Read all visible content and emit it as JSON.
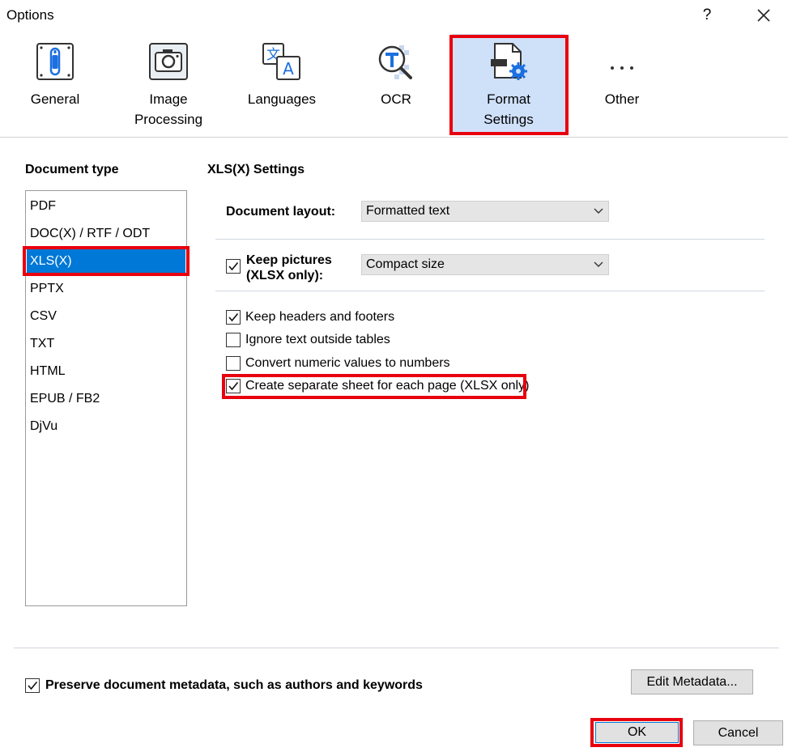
{
  "window": {
    "title": "Options",
    "help": "?"
  },
  "tabs": [
    {
      "label": "General",
      "icon": "general-icon"
    },
    {
      "label": "Image\nProcessing",
      "icon": "camera-icon"
    },
    {
      "label": "Languages",
      "icon": "languages-icon"
    },
    {
      "label": "OCR",
      "icon": "ocr-icon"
    },
    {
      "label": "Format\nSettings",
      "icon": "format-settings-icon",
      "active": true
    },
    {
      "label": "Other",
      "icon": "more-icon"
    }
  ],
  "left": {
    "header": "Document type",
    "items": [
      "PDF",
      "DOC(X) / RTF / ODT",
      "XLS(X)",
      "PPTX",
      "CSV",
      "TXT",
      "HTML",
      "EPUB / FB2",
      "DjVu"
    ],
    "selected_index": 2
  },
  "settings": {
    "header": "XLS(X) Settings",
    "layout_label": "Document layout:",
    "layout_value": "Formatted text",
    "keep_pictures_line1": "Keep pictures",
    "keep_pictures_line2": "(XLSX only):",
    "keep_pictures_checked": true,
    "pictures_value": "Compact size",
    "options": [
      {
        "label": "Keep headers and footers",
        "checked": true
      },
      {
        "label": "Ignore text outside tables",
        "checked": false
      },
      {
        "label": "Convert numeric values to numbers",
        "checked": false
      },
      {
        "label": "Create separate sheet for each page (XLSX only)",
        "checked": true
      }
    ]
  },
  "footer": {
    "metadata_label": "Preserve document metadata, such as authors and keywords",
    "metadata_checked": true,
    "edit_metadata": "Edit Metadata...",
    "ok": "OK",
    "cancel": "Cancel"
  },
  "colors": {
    "accent": "#0078d7",
    "highlight": "#e8000e",
    "active_tab": "#cfe0f9"
  }
}
